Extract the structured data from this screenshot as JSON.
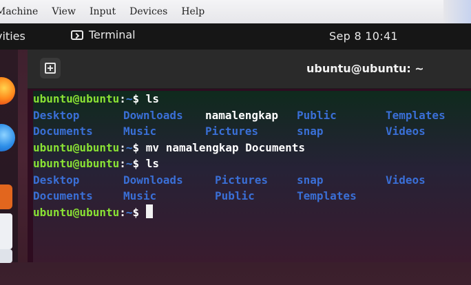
{
  "vm_menu": {
    "items": [
      "Machine",
      "View",
      "Input",
      "Devices",
      "Help"
    ]
  },
  "ubuntu_topbar": {
    "activities": "vities",
    "app_name": "Terminal",
    "clock": "Sep 8  10:41"
  },
  "dock": {
    "icons": [
      "firefox-icon",
      "thunderbird-icon",
      "app-icon",
      "files-icon",
      "files-icon"
    ]
  },
  "terminal": {
    "title": "ubuntu@ubuntu: ~",
    "prompt": {
      "user": "ubuntu@ubuntu",
      "colon": ":",
      "path": "~",
      "dollar": "$"
    },
    "commands": [
      "ls",
      "mv namalengkap Documents",
      "ls"
    ],
    "ls1": {
      "row1": [
        "Desktop",
        "Downloads",
        "namalengkap",
        "Public",
        "Templates"
      ],
      "row2": [
        "Documents",
        "Music",
        "Pictures",
        "snap",
        "Videos"
      ]
    },
    "ls2": {
      "row1": [
        "Desktop",
        "Downloads",
        "Pictures",
        "snap",
        "Videos"
      ],
      "row2": [
        "Documents",
        "Music",
        "Public",
        "Templates"
      ]
    },
    "file_item": "namalengkap",
    "colors": {
      "user": "#8ae234",
      "dir": "#3a6fd6",
      "background": "#2e0c20"
    }
  }
}
